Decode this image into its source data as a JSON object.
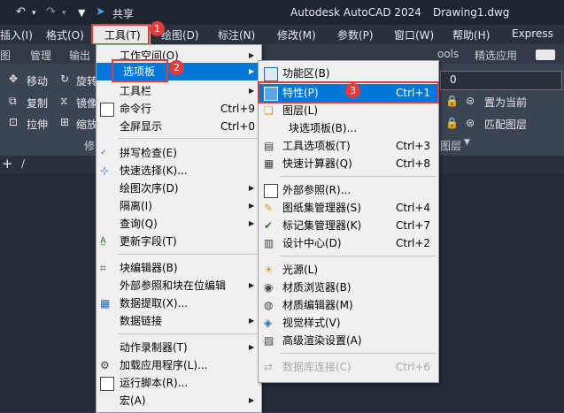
{
  "titlebar": {
    "share_label": "共享",
    "app_title": "Autodesk AutoCAD 2024",
    "document": "Drawing1.dwg"
  },
  "menubar": {
    "items": [
      "插入(I)",
      "格式(O)",
      "工具(T)",
      "绘图(D)",
      "标注(N)",
      "修改(M)",
      "参数(P)",
      "窗口(W)",
      "帮助(H)",
      "Express"
    ]
  },
  "ribbon_tabs": [
    "图",
    "管理",
    "输出",
    "ools",
    "精选应用"
  ],
  "ribbon": {
    "move": "移动",
    "rotate": "旋转",
    "copy": "复制",
    "mirror": "镜像",
    "stretch": "拉伸",
    "scale": "缩放",
    "modify_panel": "修",
    "layer_value": "0",
    "set_current": "置为当前",
    "match_layer": "匹配图层",
    "layer_panel": "图层"
  },
  "filetabs": {
    "plus": "+",
    "slash": "/"
  },
  "tools_menu": {
    "items": [
      {
        "label": "工作空间(O)",
        "shortcut": "",
        "arrow": true
      },
      {
        "label": "选项板",
        "shortcut": "",
        "arrow": true
      },
      {
        "label": "工具栏",
        "shortcut": "",
        "arrow": true
      },
      {
        "label": "命令行",
        "shortcut": "Ctrl+9",
        "arrow": false
      },
      {
        "label": "全屏显示",
        "shortcut": "Ctrl+0",
        "arrow": false
      },
      {
        "label": "拼写检查(E)",
        "shortcut": "",
        "arrow": false
      },
      {
        "label": "快速选择(K)...",
        "shortcut": "",
        "arrow": false
      },
      {
        "label": "绘图次序(D)",
        "shortcut": "",
        "arrow": true
      },
      {
        "label": "隔离(I)",
        "shortcut": "",
        "arrow": true
      },
      {
        "label": "查询(Q)",
        "shortcut": "",
        "arrow": true
      },
      {
        "label": "更新字段(T)",
        "shortcut": "",
        "arrow": false
      },
      {
        "label": "块编辑器(B)",
        "shortcut": "",
        "arrow": false
      },
      {
        "label": "外部参照和块在位编辑",
        "shortcut": "",
        "arrow": true
      },
      {
        "label": "数据提取(X)...",
        "shortcut": "",
        "arrow": false
      },
      {
        "label": "数据链接",
        "shortcut": "",
        "arrow": true
      },
      {
        "label": "动作录制器(T)",
        "shortcut": "",
        "arrow": true
      },
      {
        "label": "加载应用程序(L)...",
        "shortcut": "",
        "arrow": false
      },
      {
        "label": "运行脚本(R)...",
        "shortcut": "",
        "arrow": false
      },
      {
        "label": "宏(A)",
        "shortcut": "",
        "arrow": true
      }
    ]
  },
  "palettes_menu": {
    "items": [
      {
        "label": "功能区(B)",
        "shortcut": ""
      },
      {
        "label": "特性(P)",
        "shortcut": "Ctrl+1"
      },
      {
        "label": "图层(L)",
        "shortcut": ""
      },
      {
        "label": "块选项板(B)...",
        "shortcut": ""
      },
      {
        "label": "工具选项板(T)",
        "shortcut": "Ctrl+3"
      },
      {
        "label": "快速计算器(Q)",
        "shortcut": "Ctrl+8"
      },
      {
        "label": "外部参照(R)...",
        "shortcut": ""
      },
      {
        "label": "图纸集管理器(S)",
        "shortcut": "Ctrl+4"
      },
      {
        "label": "标记集管理器(K)",
        "shortcut": "Ctrl+7"
      },
      {
        "label": "设计中心(D)",
        "shortcut": "Ctrl+2"
      },
      {
        "label": "光源(L)",
        "shortcut": ""
      },
      {
        "label": "材质浏览器(B)",
        "shortcut": ""
      },
      {
        "label": "材质编辑器(M)",
        "shortcut": ""
      },
      {
        "label": "视觉样式(V)",
        "shortcut": ""
      },
      {
        "label": "高级渲染设置(A)",
        "shortcut": ""
      },
      {
        "label": "数据库连接(C)",
        "shortcut": "Ctrl+6"
      }
    ]
  },
  "badges": [
    "1",
    "2",
    "3"
  ],
  "colors": {
    "highlight": "#0078d7",
    "annotation": "#e23b3b"
  }
}
